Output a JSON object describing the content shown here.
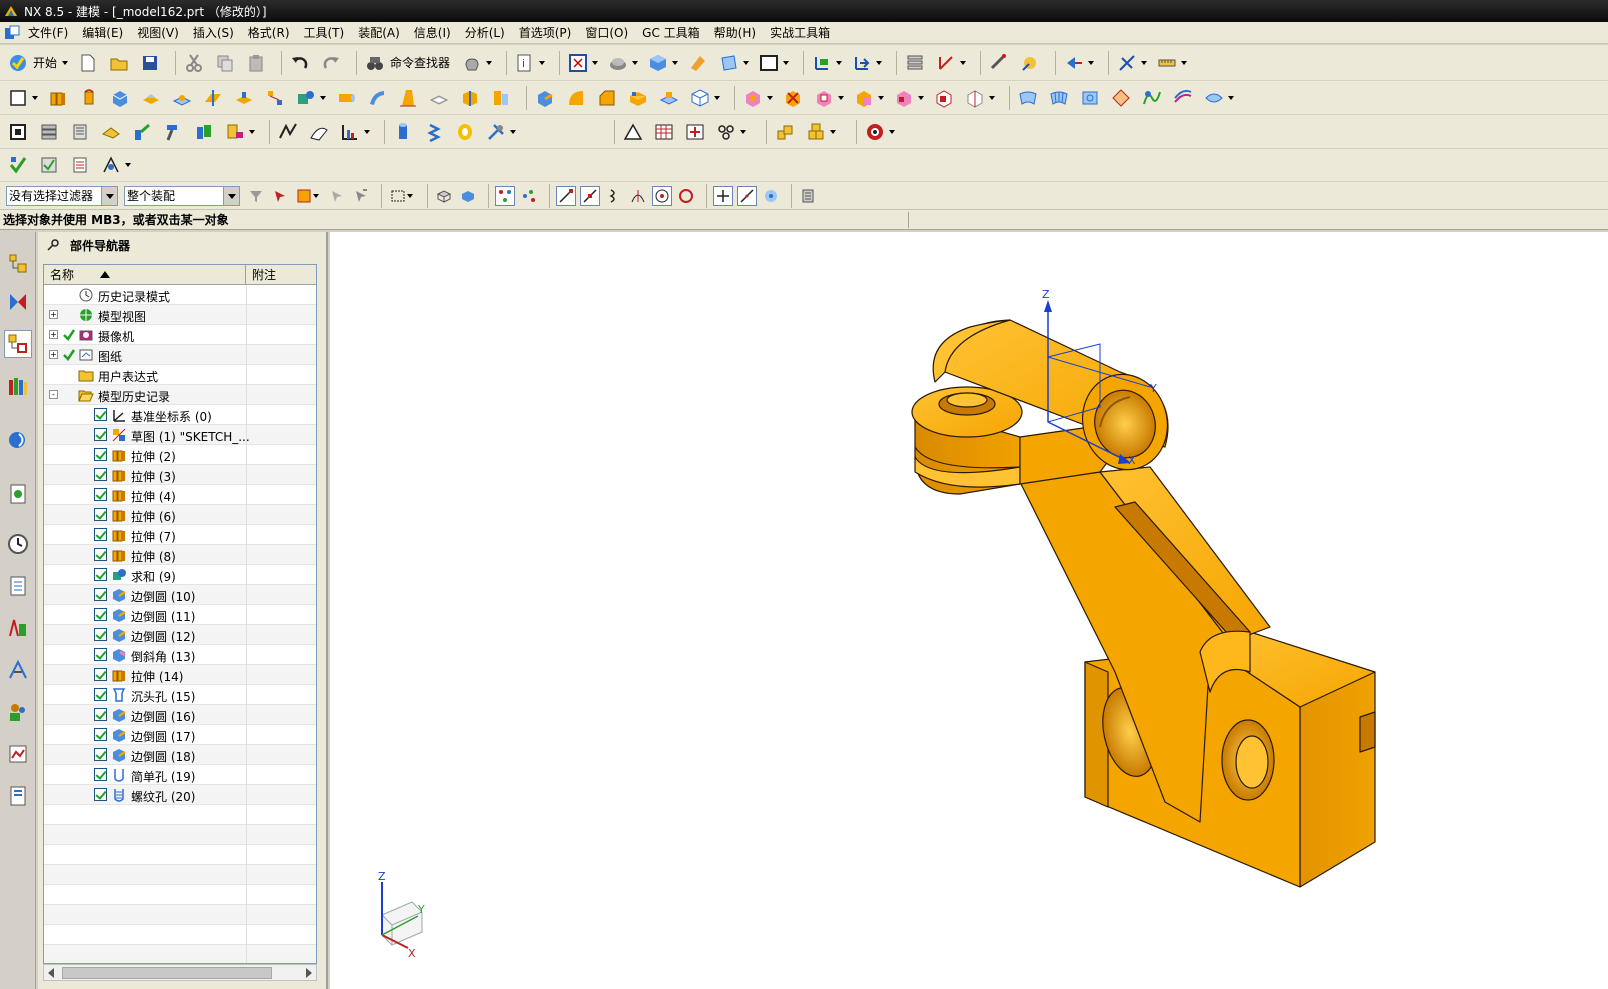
{
  "window": {
    "title": "NX 8.5 - 建模 - [_model162.prt （修改的）]"
  },
  "menu": [
    {
      "label": "文件(F)"
    },
    {
      "label": "编辑(E)"
    },
    {
      "label": "视图(V)"
    },
    {
      "label": "插入(S)"
    },
    {
      "label": "格式(R)"
    },
    {
      "label": "工具(T)"
    },
    {
      "label": "装配(A)"
    },
    {
      "label": "信息(I)"
    },
    {
      "label": "分析(L)"
    },
    {
      "label": "首选项(P)"
    },
    {
      "label": "窗口(O)"
    },
    {
      "label": "GC 工具箱"
    },
    {
      "label": "帮助(H)"
    },
    {
      "label": "实战工具箱"
    }
  ],
  "toolbar": {
    "start_label": "开始",
    "command_finder_label": "命令查找器"
  },
  "selection_bar": {
    "filter_value": "没有选择过滤器",
    "scope_value": "整个装配"
  },
  "cue_line": "选择对象并使用 MB3，或者双击某一对象",
  "navigator": {
    "title": "部件导航器",
    "columns": {
      "name": "名称",
      "note": "附注"
    },
    "nodes": [
      {
        "label": "历史记录模式",
        "level": 0,
        "expand": "",
        "check": "",
        "icon": "clock-icon"
      },
      {
        "label": "模型视图",
        "level": 0,
        "expand": "+",
        "check": "",
        "icon": "model-views-icon"
      },
      {
        "label": "摄像机",
        "level": 0,
        "expand": "+",
        "check": "green",
        "icon": "camera-icon"
      },
      {
        "label": "图纸",
        "level": 0,
        "expand": "+",
        "check": "green",
        "icon": "drawing-icon"
      },
      {
        "label": "用户表达式",
        "level": 0,
        "expand": "",
        "check": "",
        "icon": "folder-icon"
      },
      {
        "label": "模型历史记录",
        "level": 0,
        "expand": "-",
        "check": "",
        "icon": "folder-open-icon"
      },
      {
        "label": "基准坐标系 (0)",
        "level": 1,
        "check": "box",
        "icon": "datum-csys-icon"
      },
      {
        "label": "草图 (1) \"SKETCH_...",
        "level": 1,
        "check": "box",
        "icon": "sketch-icon"
      },
      {
        "label": "拉伸 (2)",
        "level": 1,
        "check": "box",
        "icon": "extrude-icon"
      },
      {
        "label": "拉伸 (3)",
        "level": 1,
        "check": "box",
        "icon": "extrude-icon"
      },
      {
        "label": "拉伸 (4)",
        "level": 1,
        "check": "box",
        "icon": "extrude-icon"
      },
      {
        "label": "拉伸 (6)",
        "level": 1,
        "check": "box",
        "icon": "extrude-icon"
      },
      {
        "label": "拉伸 (7)",
        "level": 1,
        "check": "box",
        "icon": "extrude-icon"
      },
      {
        "label": "拉伸 (8)",
        "level": 1,
        "check": "box",
        "icon": "extrude-icon"
      },
      {
        "label": "求和 (9)",
        "level": 1,
        "check": "box",
        "icon": "unite-icon"
      },
      {
        "label": "边倒圆 (10)",
        "level": 1,
        "check": "box",
        "icon": "edge-blend-icon"
      },
      {
        "label": "边倒圆 (11)",
        "level": 1,
        "check": "box",
        "icon": "edge-blend-icon"
      },
      {
        "label": "边倒圆 (12)",
        "level": 1,
        "check": "box",
        "icon": "edge-blend-icon"
      },
      {
        "label": "倒斜角 (13)",
        "level": 1,
        "check": "box",
        "icon": "chamfer-icon"
      },
      {
        "label": "拉伸 (14)",
        "level": 1,
        "check": "box",
        "icon": "extrude-icon"
      },
      {
        "label": "沉头孔 (15)",
        "level": 1,
        "check": "box",
        "icon": "counterbore-hole-icon"
      },
      {
        "label": "边倒圆 (16)",
        "level": 1,
        "check": "box",
        "icon": "edge-blend-icon"
      },
      {
        "label": "边倒圆 (17)",
        "level": 1,
        "check": "box",
        "icon": "edge-blend-icon"
      },
      {
        "label": "边倒圆 (18)",
        "level": 1,
        "check": "box",
        "icon": "edge-blend-icon"
      },
      {
        "label": "简单孔 (19)",
        "level": 1,
        "check": "box",
        "icon": "simple-hole-icon"
      },
      {
        "label": "螺纹孔 (20)",
        "level": 1,
        "check": "box",
        "icon": "threaded-hole-icon"
      }
    ]
  },
  "viewport": {
    "csys_labels": {
      "z": "Z",
      "y": "Y",
      "x": "X"
    },
    "triad_labels": {
      "z": "Z",
      "y": "Y",
      "x": "X"
    }
  },
  "colors": {
    "model_fill": "#f5a500",
    "model_shade": "#c87a00",
    "model_light": "#ffc233",
    "model_edge": "#2a1a00",
    "titlebar": "#1a1a1a"
  }
}
